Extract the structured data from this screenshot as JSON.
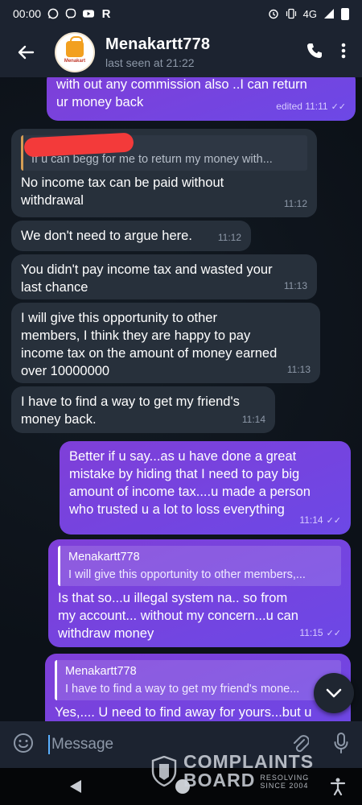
{
  "status_bar": {
    "time": "00:00",
    "left_icons": [
      "whatsapp-icon",
      "viber-icon",
      "youtube-icon",
      "r-app-icon"
    ],
    "network": "4G",
    "right_icons": [
      "alarm-icon",
      "vibrate-icon",
      "signal-icon",
      "battery-icon"
    ]
  },
  "header": {
    "title": "Menakartt778",
    "subtitle": "last seen at 21:22",
    "avatar_text": "Menakart",
    "icons": [
      "back-arrow-icon",
      "phone-icon",
      "more-vert-icon"
    ]
  },
  "messages": [
    {
      "id": "m1",
      "dir": "out",
      "lines": [
        "with out any commission also ..I can return",
        "ur money back"
      ],
      "time": "edited 11:11",
      "status": "read"
    },
    {
      "id": "m2",
      "dir": "in",
      "reply_text": "If u can begg for me to return my money with...",
      "lines": [
        "No income tax can be paid without",
        "withdrawal"
      ],
      "time": "11:12"
    },
    {
      "id": "m3",
      "dir": "in",
      "lines": [
        "We don't need to argue here."
      ],
      "time": "11:12"
    },
    {
      "id": "m4",
      "dir": "in",
      "lines": [
        "You didn't pay income tax and wasted your",
        "last chance"
      ],
      "time": "11:13"
    },
    {
      "id": "m5",
      "dir": "in",
      "lines": [
        "I will give this opportunity to other",
        "members, I think they are happy to pay",
        "income tax on the amount of money earned",
        "over 10000000"
      ],
      "time": "11:13"
    },
    {
      "id": "m6",
      "dir": "in",
      "lines": [
        "I have to find a way to get my friend's",
        "money back."
      ],
      "time": "11:14"
    },
    {
      "id": "m7",
      "dir": "out",
      "lines": [
        "Better if u say...as u have done a great",
        "mistake by hiding that I need to pay big",
        "amount of income tax....u made a person",
        "who trusted u a lot to loss everything"
      ],
      "time": "11:14",
      "status": "read"
    },
    {
      "id": "m8",
      "dir": "out",
      "reply_name": "Menakartt778",
      "reply_text": "I will give this opportunity to other members,...",
      "lines": [
        "Is that so...u illegal system na.. so from",
        "my account... without my concern...u can",
        "withdraw money"
      ],
      "time": "11:15",
      "status": "read"
    },
    {
      "id": "m9",
      "dir": "out",
      "reply_name": "Menakartt778",
      "reply_text": "I have to find a way to get my friend's mone...",
      "lines": [
        "Yes,.... U need to find away for yours...but u"
      ],
      "time": "",
      "status": ""
    }
  ],
  "composer": {
    "placeholder": "Message",
    "icons": [
      "emoji-icon",
      "attach-icon",
      "mic-icon"
    ]
  },
  "scroll_down": {
    "icon": "chevron-down-icon"
  },
  "watermark": {
    "line1": "COMPLAINTS",
    "line2": "BOARD",
    "tag1": "RESOLVING",
    "tag2": "SINCE 2004"
  },
  "nav_icons": [
    "back-triangle-icon",
    "home-circle-icon",
    "recents-icon",
    "accessibility-icon"
  ],
  "colors": {
    "bg": "#0c1118",
    "bar": "#1c2330",
    "incoming": "#27303b",
    "outgoing": "#7f3fd8",
    "reply_accent": "#d49d55",
    "muted": "#8d98a8"
  }
}
